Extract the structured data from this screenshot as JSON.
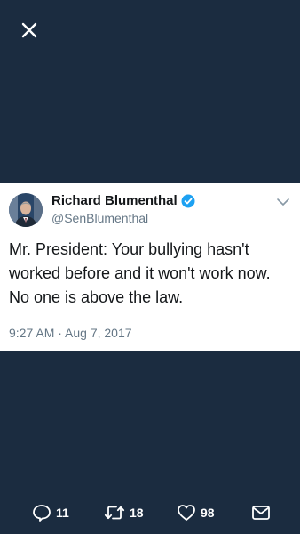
{
  "tweet": {
    "author": {
      "display_name": "Richard Blumenthal",
      "handle": "@SenBlumenthal",
      "verified": true
    },
    "text": "Mr. President: Your bullying hasn't worked before and it won't work now. No one is above the law.",
    "timestamp": "9:27 AM · Aug 7, 2017"
  },
  "actions": {
    "reply_count": "11",
    "retweet_count": "18",
    "like_count": "98"
  },
  "icons": {
    "close": "close-icon",
    "verified": "verified-badge-icon",
    "caret": "chevron-down-icon",
    "reply": "reply-icon",
    "retweet": "retweet-icon",
    "like": "heart-icon",
    "dm": "envelope-icon"
  },
  "colors": {
    "background": "#1b2c40",
    "card": "#ffffff",
    "text": "#14171a",
    "secondary_text": "#657786",
    "verified_blue": "#1da1f2"
  }
}
